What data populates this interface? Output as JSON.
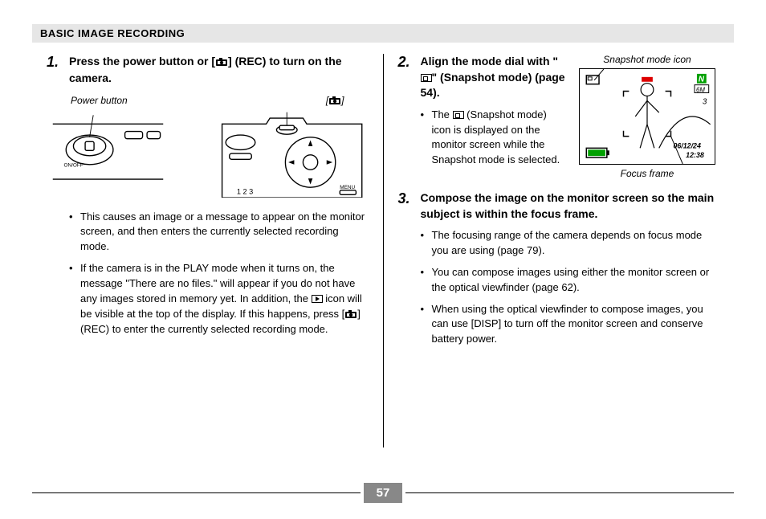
{
  "header": {
    "title": "BASIC IMAGE RECORDING"
  },
  "left": {
    "step1": {
      "num": "1.",
      "title_a": "Press the power button or [",
      "title_b": "] (REC) to turn on the camera.",
      "label_power": "Power button",
      "label_rec": "[        ]",
      "bullets": [
        "This causes an image or a message to appear on the monitor screen, and then enters the currently selected recording mode."
      ],
      "bullet2_a": "If the camera is in the PLAY mode when it turns on, the message \"There are no files.\" will appear if you do not have any images stored in memory yet. In addition, the ",
      "bullet2_b": " icon will be visible at the top of the display. If this happens, press [",
      "bullet2_c": "] (REC) to enter the currently selected recording mode."
    }
  },
  "right": {
    "step2": {
      "num": "2.",
      "title_a": "Align the mode dial with \"",
      "title_b": "\" (Snapshot mode) (page 54).",
      "bullet_a": "The ",
      "bullet_b": " (Snapshot mode) icon is displayed on the monitor screen while the Snapshot mode is selected.",
      "caption_top": "Snapshot mode icon",
      "caption_bottom": "Focus frame",
      "lcd": {
        "date": "06/12/24",
        "time": "12:38",
        "res": "6M",
        "count": "3"
      }
    },
    "step3": {
      "num": "3.",
      "title": "Compose the image on the monitor screen so the main subject is within the focus frame.",
      "bullets": [
        "The focusing range of the camera depends on focus mode you are using (page 79).",
        "You can compose images using either the monitor screen or the optical viewfinder (page 62).",
        "When using the optical viewfinder to compose images, you can use [DISP] to turn off the monitor screen and conserve battery power."
      ]
    }
  },
  "footer": {
    "page": "57"
  }
}
